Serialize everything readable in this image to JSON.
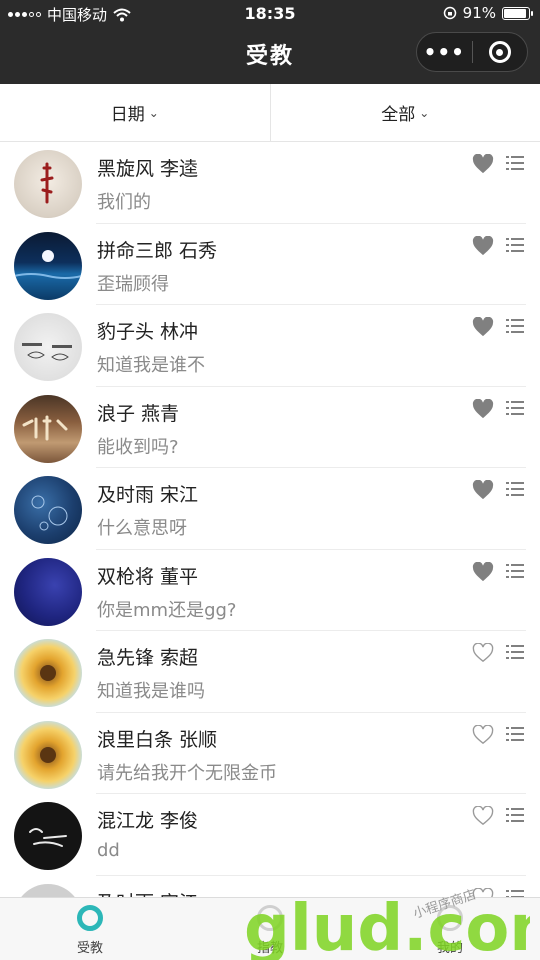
{
  "status": {
    "carrier": "中国移动",
    "time": "18:35",
    "battery": "91%"
  },
  "nav": {
    "title": "受教",
    "more": "•••"
  },
  "filters": [
    {
      "label": "日期",
      "chev": "⌄"
    },
    {
      "label": "全部",
      "chev": "⌄"
    }
  ],
  "list": [
    {
      "name": "黑旋风 李逵",
      "msg": "我们的",
      "liked": true
    },
    {
      "name": "拼命三郎 石秀",
      "msg": "歪瑞顾得",
      "liked": true
    },
    {
      "name": "豹子头 林冲",
      "msg": "知道我是谁不",
      "liked": true
    },
    {
      "name": "浪子 燕青",
      "msg": "能收到吗?",
      "liked": true
    },
    {
      "name": "及时雨 宋江",
      "msg": "什么意思呀",
      "liked": true
    },
    {
      "name": "双枪将 董平",
      "msg": "你是mm还是gg?",
      "liked": true
    },
    {
      "name": "急先锋 索超",
      "msg": "知道我是谁吗",
      "liked": false
    },
    {
      "name": "浪里白条 张顺",
      "msg": "请先给我开个无限金币",
      "liked": false
    },
    {
      "name": "混江龙 李俊",
      "msg": "dd",
      "liked": false
    },
    {
      "name": "及时雨 宋江",
      "msg": "",
      "liked": false
    }
  ],
  "tabs": [
    {
      "label": "受教",
      "active": true
    },
    {
      "label": "指教",
      "active": false
    },
    {
      "label": "我的",
      "active": false
    }
  ],
  "watermark": {
    "text": "glud.com",
    "slogan": "小程序商店"
  },
  "colors": {
    "accent": "#2cb7b8",
    "header": "#2b2b2b",
    "watermark": "#7ed321"
  }
}
